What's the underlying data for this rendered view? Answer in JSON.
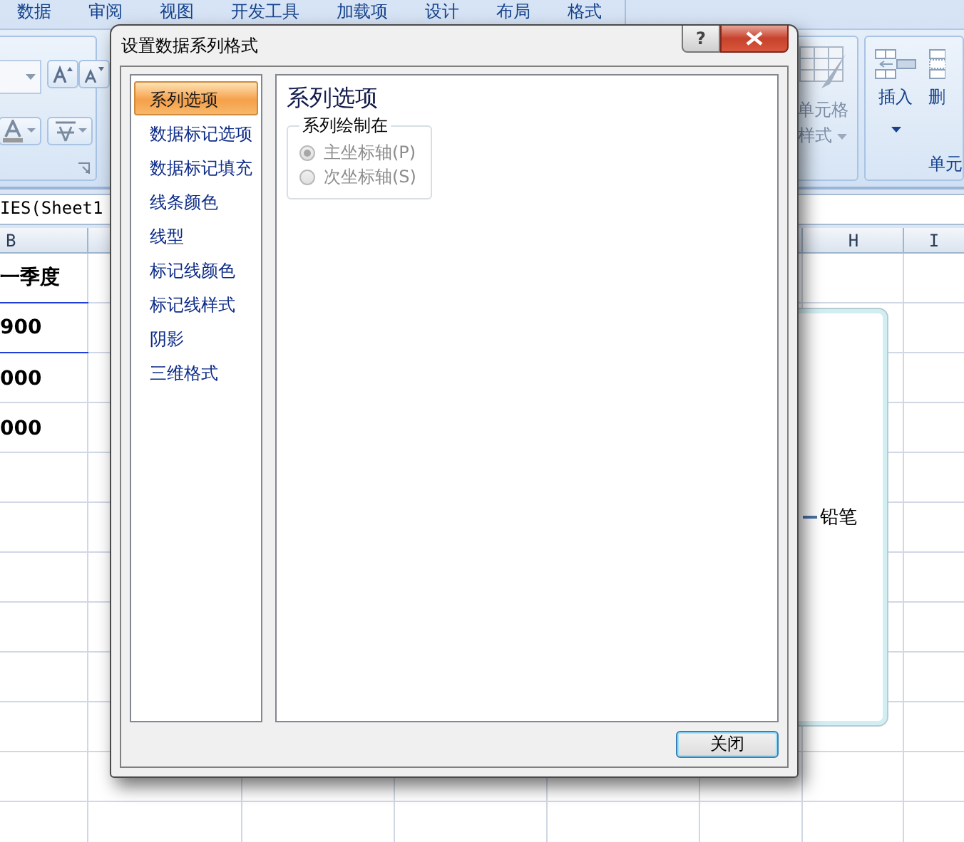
{
  "ribbon": {
    "tabs": [
      {
        "label": "数据"
      },
      {
        "label": "审阅"
      },
      {
        "label": "视图"
      },
      {
        "label": "开发工具"
      },
      {
        "label": "加载项"
      },
      {
        "label": "设计"
      },
      {
        "label": "布局"
      },
      {
        "label": "格式"
      }
    ],
    "cell_styles_button": "单元格样式",
    "insert_button": "插入",
    "delete_button": "删",
    "cells_group_label": "单元"
  },
  "formula_bar": {
    "value": "IES(Sheet1"
  },
  "sheet": {
    "column_headers": [
      "B",
      "H",
      "I"
    ],
    "column_b_cells": [
      "一季度",
      "900",
      "000",
      "000"
    ]
  },
  "chart": {
    "legend": [
      {
        "label": "铅笔"
      }
    ]
  },
  "dialog": {
    "title": "设置数据系列格式",
    "help_button": "?",
    "nav": [
      {
        "label": "系列选项",
        "selected": true
      },
      {
        "label": "数据标记选项",
        "selected": false
      },
      {
        "label": "数据标记填充",
        "selected": false
      },
      {
        "label": "线条颜色",
        "selected": false
      },
      {
        "label": "线型",
        "selected": false
      },
      {
        "label": "标记线颜色",
        "selected": false
      },
      {
        "label": "标记线样式",
        "selected": false
      },
      {
        "label": "阴影",
        "selected": false
      },
      {
        "label": "三维格式",
        "selected": false
      }
    ],
    "heading": "系列选项",
    "plot_on": {
      "legend": "系列绘制在",
      "disabled": true,
      "options": [
        {
          "label": "主坐标轴(P)",
          "selected": true
        },
        {
          "label": "次坐标轴(S)",
          "selected": false
        }
      ]
    },
    "close_button": "关闭"
  }
}
